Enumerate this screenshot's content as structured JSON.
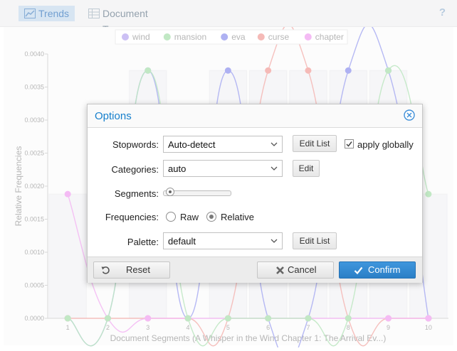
{
  "tabs": [
    {
      "label": "Trends",
      "icon": "line-chart-icon",
      "active": true
    },
    {
      "label": "Document Terms",
      "icon": "table-icon",
      "active": false
    }
  ],
  "help_label": "?",
  "chart_data": {
    "type": "line",
    "legend": [
      {
        "name": "wind",
        "color": "#b9a8f0"
      },
      {
        "name": "mansion",
        "color": "#a9dfae"
      },
      {
        "name": "eva",
        "color": "#8f93ee"
      },
      {
        "name": "curse",
        "color": "#f2a09c"
      },
      {
        "name": "chapter",
        "color": "#f0a1f0"
      }
    ],
    "legend_position": "top",
    "ylabel": "Relative Frequencies",
    "xlabel": "Document Segments (A Whisper in the Wind Chapter 1: The Arrival Ev...)",
    "y_ticks": [
      "0.0000",
      "0.0005",
      "0.0010",
      "0.0015",
      "0.0020",
      "0.0025",
      "0.0030",
      "0.0035",
      "0.0040"
    ],
    "x_ticks": [
      "1",
      "2",
      "3",
      "4",
      "5",
      "6",
      "7",
      "8",
      "9",
      "10"
    ],
    "ylim": [
      0,
      0.004
    ],
    "categories": [
      1,
      2,
      3,
      4,
      5,
      6,
      7,
      8,
      9,
      10
    ],
    "series": [
      {
        "name": "eva",
        "color": "#8f93ee",
        "values": [
          0.0,
          0.0,
          0.00375,
          0.0,
          0.00375,
          0.0,
          0.0,
          0.00375,
          0.00375,
          0.0
        ]
      },
      {
        "name": "curse",
        "color": "#f2a09c",
        "values": [
          0.0,
          0.0,
          0.0,
          0.0,
          0.0,
          0.00375,
          0.00375,
          0.0,
          0.0,
          0.0
        ]
      },
      {
        "name": "chapter",
        "color": "#f0a1f0",
        "values": [
          0.00188,
          0.0,
          0.0,
          0.0,
          0.0,
          0.0,
          0.0,
          0.0,
          0.0,
          0.0
        ]
      },
      {
        "name": "mansion",
        "color": "#a9dfae",
        "values": [
          0.0,
          0.0,
          0.00375,
          0.0,
          0.0,
          0.0,
          0.0,
          0.0,
          0.00375,
          0.00188
        ]
      }
    ],
    "bars": [
      0.00188,
      0.0,
      0.00375,
      0.0,
      0.00375,
      0.00375,
      0.00375,
      0.00375,
      0.00375,
      0.00188
    ],
    "grid": false
  },
  "dialog": {
    "title": "Options",
    "stopwords_label": "Stopwords:",
    "stopwords_value": "Auto-detect",
    "stopwords_edit": "Edit List",
    "apply_globally": "apply globally",
    "apply_globally_checked": true,
    "categories_label": "Categories:",
    "categories_value": "auto",
    "categories_edit": "Edit",
    "segments_label": "Segments:",
    "frequencies_label": "Frequencies:",
    "freq_raw": "Raw",
    "freq_relative": "Relative",
    "freq_selected": "Relative",
    "palette_label": "Palette:",
    "palette_value": "default",
    "palette_edit": "Edit List",
    "reset_label": "Reset",
    "cancel_label": "Cancel",
    "confirm_label": "Confirm"
  }
}
